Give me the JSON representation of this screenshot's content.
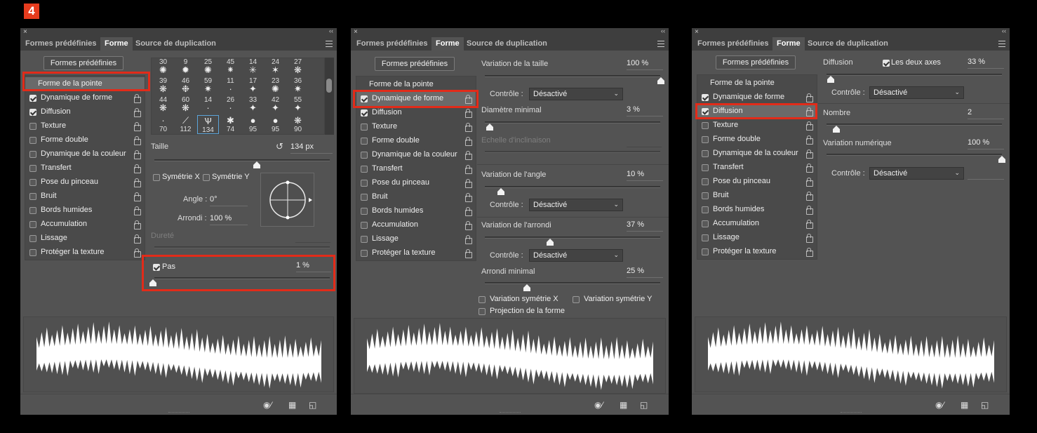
{
  "badge": "4",
  "tabs": [
    "Formes prédéfinies",
    "Forme",
    "Source de duplication"
  ],
  "preset_button": "Formes prédéfinies",
  "list": {
    "head": "Forme de la pointe",
    "items": [
      "Dynamique de forme",
      "Diffusion",
      "Texture",
      "Forme double",
      "Dynamique de la couleur",
      "Transfert",
      "Pose du pinceau",
      "Bruit",
      "Bords humides",
      "Accumulation",
      "Lissage",
      "Protéger la texture"
    ]
  },
  "p1": {
    "checked": [
      true,
      true,
      false,
      false,
      false,
      false,
      false,
      false,
      false,
      false,
      false,
      false
    ],
    "brushes": [
      {
        "n": "30",
        "g": "✺"
      },
      {
        "n": "9",
        "g": "✹"
      },
      {
        "n": "25",
        "g": "✺"
      },
      {
        "n": "45",
        "g": "⁕"
      },
      {
        "n": "14",
        "g": "✳"
      },
      {
        "n": "24",
        "g": "✶"
      },
      {
        "n": "27",
        "g": "❋"
      },
      {
        "n": "39",
        "g": "❋"
      },
      {
        "n": "46",
        "g": "❉"
      },
      {
        "n": "59",
        "g": "✷"
      },
      {
        "n": "11",
        "g": "∙"
      },
      {
        "n": "17",
        "g": "✦"
      },
      {
        "n": "23",
        "g": "✺"
      },
      {
        "n": "36",
        "g": "✷"
      },
      {
        "n": "44",
        "g": "❋"
      },
      {
        "n": "60",
        "g": "❋"
      },
      {
        "n": "14",
        "g": "·"
      },
      {
        "n": "26",
        "g": "·"
      },
      {
        "n": "33",
        "g": "✦"
      },
      {
        "n": "42",
        "g": "✦"
      },
      {
        "n": "55",
        "g": "✦"
      },
      {
        "n": "70",
        "g": "·"
      },
      {
        "n": "112",
        "g": "⟋"
      },
      {
        "n": "134",
        "g": "Ѱ"
      },
      {
        "n": "74",
        "g": "✱"
      },
      {
        "n": "95",
        "g": "●"
      },
      {
        "n": "95",
        "g": "●"
      },
      {
        "n": "90",
        "g": "❋"
      }
    ],
    "size_label": "Taille",
    "size_value": "134 px",
    "sym_x": "Symétrie X",
    "sym_y": "Symétrie Y",
    "angle_label": "Angle :",
    "angle_value": "0°",
    "round_label": "Arrondi :",
    "round_value": "100 %",
    "hardness_label": "Dureté",
    "spacing_label": "Pas",
    "spacing_value": "1 %"
  },
  "p2": {
    "checked": [
      true,
      true,
      false,
      false,
      false,
      false,
      false,
      false,
      false,
      false,
      false,
      false
    ],
    "size_var": "Variation de la taille",
    "size_var_val": "100 %",
    "control": "Contrôle :",
    "off": "Désactivé",
    "min_diam": "Diamètre minimal",
    "min_diam_val": "3 %",
    "tilt": "Echelle d'inclinaison",
    "angle_var": "Variation de l'angle",
    "angle_var_val": "10 %",
    "round_var": "Variation de l'arrondi",
    "round_var_val": "37 %",
    "min_round": "Arrondi minimal",
    "min_round_val": "25 %",
    "flip_x": "Variation symétrie X",
    "flip_y": "Variation symétrie Y",
    "proj": "Projection de la forme"
  },
  "p3": {
    "checked": [
      true,
      true,
      false,
      false,
      false,
      false,
      false,
      false,
      false,
      false,
      false,
      false
    ],
    "scatter": "Diffusion",
    "both_axes": "Les deux axes",
    "scatter_val": "33 %",
    "control": "Contrôle :",
    "off": "Désactivé",
    "count": "Nombre",
    "count_val": "2",
    "count_jitter": "Variation numérique",
    "count_jitter_val": "100 %"
  }
}
